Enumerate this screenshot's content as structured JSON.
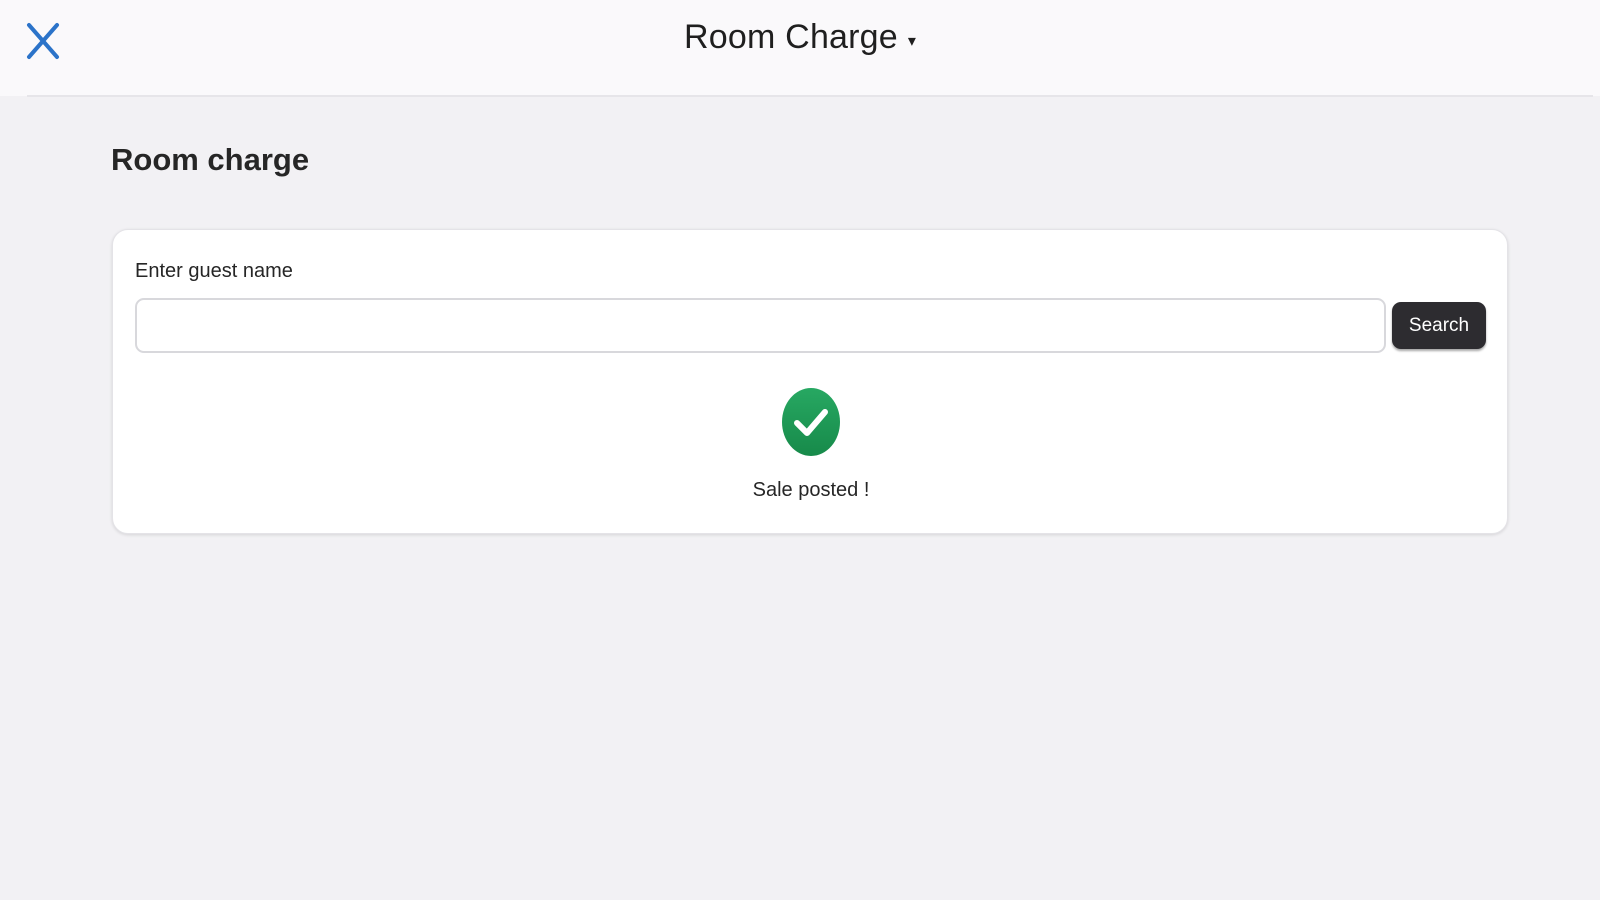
{
  "header": {
    "title": "Room Charge",
    "caret": "▾",
    "close_icon": "close-icon",
    "accent_color": "#2b73c9"
  },
  "page": {
    "heading": "Room charge"
  },
  "form": {
    "guest_label": "Enter guest name",
    "guest_value": "",
    "search_label": "Search"
  },
  "status": {
    "icon": "check-circle-icon",
    "color": "#1f9a57",
    "message": "Sale posted !"
  }
}
